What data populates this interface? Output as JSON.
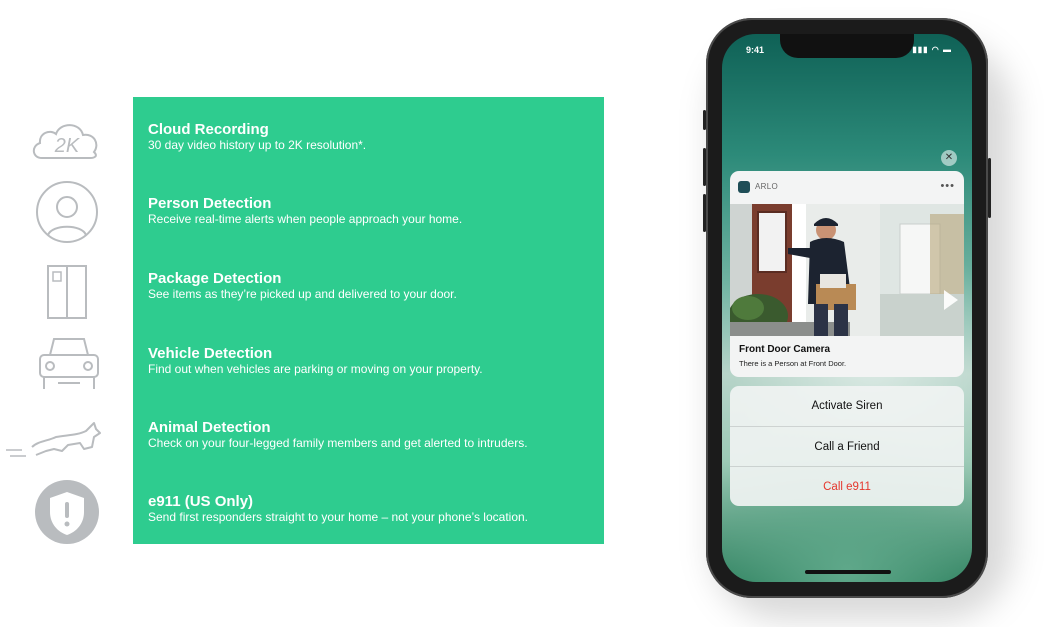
{
  "features": [
    {
      "title": "Cloud Recording",
      "desc": "30 day video history up to 2K resolution*.",
      "icon": "cloud-2k-icon"
    },
    {
      "title": "Person Detection",
      "desc": "Receive real-time alerts when people approach your home.",
      "icon": "person-icon"
    },
    {
      "title": "Package Detection",
      "desc": "See items as they’re picked up and delivered to your door.",
      "icon": "package-icon"
    },
    {
      "title": "Vehicle Detection",
      "desc": "Find out when vehicles are parking or moving on your property.",
      "icon": "vehicle-icon"
    },
    {
      "title": "Animal Detection",
      "desc": "Check on your four-legged family members and get alerted to intruders.",
      "icon": "animal-icon"
    },
    {
      "title": "e911 (US Only)",
      "desc": "Send first responders straight to your home – not your phone’s location.",
      "icon": "shield-alert-icon"
    }
  ],
  "icons": {
    "cloud_label": "2K"
  },
  "phone": {
    "status_time": "9:41",
    "status_icons": "▮▮▮ ◠ ▬",
    "notification": {
      "app_name": "ARLO",
      "title": "Front Door Camera",
      "body": "There is a Person at Front Door."
    },
    "actions": [
      "Activate Siren",
      "Call a Friend",
      "Call e911"
    ]
  },
  "colors": {
    "panel": "#2ecc8f",
    "alert_text": "#e5372d",
    "icon_gray": "#b9bcbf"
  }
}
